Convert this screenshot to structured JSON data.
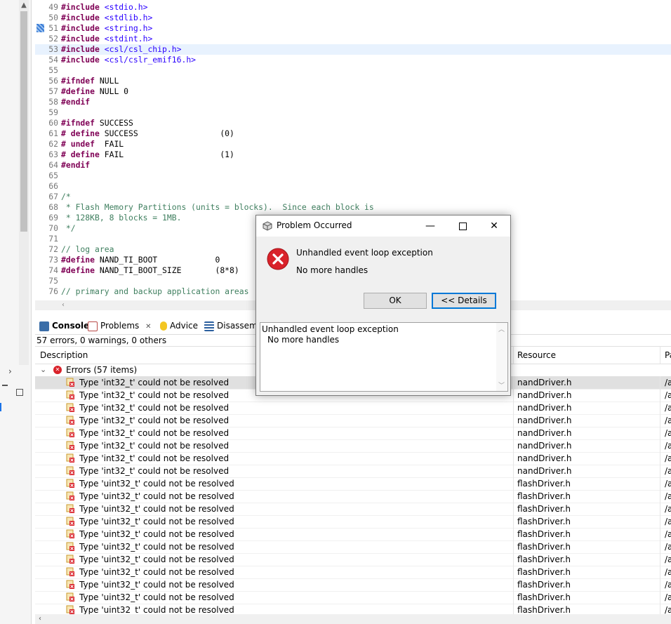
{
  "editor": {
    "lines": [
      {
        "num": "49",
        "kw": "#include",
        "rest": " <stdio.h>",
        "type": "inc"
      },
      {
        "num": "50",
        "kw": "#include",
        "rest": " <stdlib.h>",
        "type": "inc"
      },
      {
        "num": "51",
        "kw": "#include",
        "rest": " <string.h>",
        "type": "inc"
      },
      {
        "num": "52",
        "kw": "#include",
        "rest": " <stdint.h>",
        "type": "inc"
      },
      {
        "num": "53",
        "kw": "#include",
        "rest": " <csl/csl_chip.h>",
        "type": "inc",
        "highlight": true
      },
      {
        "num": "54",
        "kw": "#include",
        "rest": " <csl/cslr_emif16.h>",
        "type": "inc"
      },
      {
        "num": "55",
        "kw": "",
        "rest": "",
        "type": "plain"
      },
      {
        "num": "56",
        "kw": "#ifndef",
        "rest": " NULL",
        "type": "plain"
      },
      {
        "num": "57",
        "kw": "#define",
        "rest": " NULL 0",
        "type": "plain"
      },
      {
        "num": "58",
        "kw": "#endif",
        "rest": "",
        "type": "plain"
      },
      {
        "num": "59",
        "kw": "",
        "rest": "",
        "type": "plain"
      },
      {
        "num": "60",
        "kw": "#ifndef",
        "rest": " SUCCESS",
        "type": "plain"
      },
      {
        "num": "61",
        "kw": "# define",
        "rest": " SUCCESS                 (0)",
        "type": "plain"
      },
      {
        "num": "62",
        "kw": "# undef",
        "rest": "  FAIL",
        "type": "plain"
      },
      {
        "num": "63",
        "kw": "# define",
        "rest": " FAIL                    (1)",
        "type": "plain"
      },
      {
        "num": "64",
        "kw": "#endif",
        "rest": "",
        "type": "plain"
      },
      {
        "num": "65",
        "kw": "",
        "rest": "",
        "type": "plain"
      },
      {
        "num": "66",
        "kw": "",
        "rest": "",
        "type": "plain"
      },
      {
        "num": "67",
        "kw": "",
        "rest": "/*",
        "type": "cm"
      },
      {
        "num": "68",
        "kw": "",
        "rest": " * Flash Memory Partitions (units = blocks).  Since each block is",
        "type": "cm"
      },
      {
        "num": "69",
        "kw": "",
        "rest": " * 128KB, 8 blocks = 1MB.",
        "type": "cm"
      },
      {
        "num": "70",
        "kw": "",
        "rest": " */",
        "type": "cm"
      },
      {
        "num": "71",
        "kw": "",
        "rest": "",
        "type": "plain"
      },
      {
        "num": "72",
        "kw": "",
        "rest": "// log area",
        "type": "cm"
      },
      {
        "num": "73",
        "kw": "#define",
        "rest": " NAND_TI_BOOT            0",
        "type": "plain"
      },
      {
        "num": "74",
        "kw": "#define",
        "rest": " NAND_TI_BOOT_SIZE       (8*8)",
        "type": "plain"
      },
      {
        "num": "75",
        "kw": "",
        "rest": "",
        "type": "plain"
      },
      {
        "num": "76",
        "kw": "",
        "rest": "// primary and backup application areas",
        "type": "cm"
      }
    ]
  },
  "views": {
    "tabs": [
      {
        "label": "Console",
        "icon": "console-icon",
        "bold": true
      },
      {
        "label": "Problems",
        "icon": "problems-icon",
        "close": "✕"
      },
      {
        "label": "Advice",
        "icon": "lightbulb-icon"
      },
      {
        "label": "Disassemb",
        "icon": "disassembly-icon"
      }
    ],
    "summary": "57 errors, 0 warnings, 0 others",
    "columns": {
      "description": "Description",
      "resource": "Resource",
      "path": "Pa"
    },
    "group_label": "Errors (57 items)",
    "rows": [
      {
        "desc": "Type 'int32_t' could not be resolved",
        "res": "nandDriver.h",
        "path": "/a"
      },
      {
        "desc": "Type 'int32_t' could not be resolved",
        "res": "nandDriver.h",
        "path": "/a"
      },
      {
        "desc": "Type 'int32_t' could not be resolved",
        "res": "nandDriver.h",
        "path": "/a"
      },
      {
        "desc": "Type 'int32_t' could not be resolved",
        "res": "nandDriver.h",
        "path": "/a"
      },
      {
        "desc": "Type 'int32_t' could not be resolved",
        "res": "nandDriver.h",
        "path": "/a"
      },
      {
        "desc": "Type 'int32_t' could not be resolved",
        "res": "nandDriver.h",
        "path": "/a"
      },
      {
        "desc": "Type 'int32_t' could not be resolved",
        "res": "nandDriver.h",
        "path": "/a"
      },
      {
        "desc": "Type 'int32_t' could not be resolved",
        "res": "nandDriver.h",
        "path": "/a"
      },
      {
        "desc": "Type 'uint32_t' could not be resolved",
        "res": "flashDriver.h",
        "path": "/a"
      },
      {
        "desc": "Type 'uint32_t' could not be resolved",
        "res": "flashDriver.h",
        "path": "/a"
      },
      {
        "desc": "Type 'uint32_t' could not be resolved",
        "res": "flashDriver.h",
        "path": "/a"
      },
      {
        "desc": "Type 'uint32_t' could not be resolved",
        "res": "flashDriver.h",
        "path": "/a"
      },
      {
        "desc": "Type 'uint32_t' could not be resolved",
        "res": "flashDriver.h",
        "path": "/a"
      },
      {
        "desc": "Type 'uint32_t' could not be resolved",
        "res": "flashDriver.h",
        "path": "/a"
      },
      {
        "desc": "Type 'uint32_t' could not be resolved",
        "res": "flashDriver.h",
        "path": "/a"
      },
      {
        "desc": "Type 'uint32_t' could not be resolved",
        "res": "flashDriver.h",
        "path": "/a"
      },
      {
        "desc": "Type 'uint32_t' could not be resolved",
        "res": "flashDriver.h",
        "path": "/a"
      },
      {
        "desc": "Type 'uint32_t' could not be resolved",
        "res": "flashDriver.h",
        "path": "/a"
      },
      {
        "desc": "Type 'uint32_t' could not be resolved",
        "res": "flashDriver.h",
        "path": "/a"
      }
    ]
  },
  "dialog": {
    "title": "Problem Occurred",
    "message": "Unhandled event loop exception",
    "sub": "No more handles",
    "ok_label": "OK",
    "details_label": "<< Details",
    "details_line1": "Unhandled event loop exception",
    "details_line2": "No more handles",
    "minimize": "—",
    "close": "✕"
  },
  "colors": {
    "error_red": "#d9222a",
    "keyword": "#7f0055",
    "include": "#2a00ff",
    "comment": "#3f7f5f",
    "focus_blue": "#0078d7"
  }
}
